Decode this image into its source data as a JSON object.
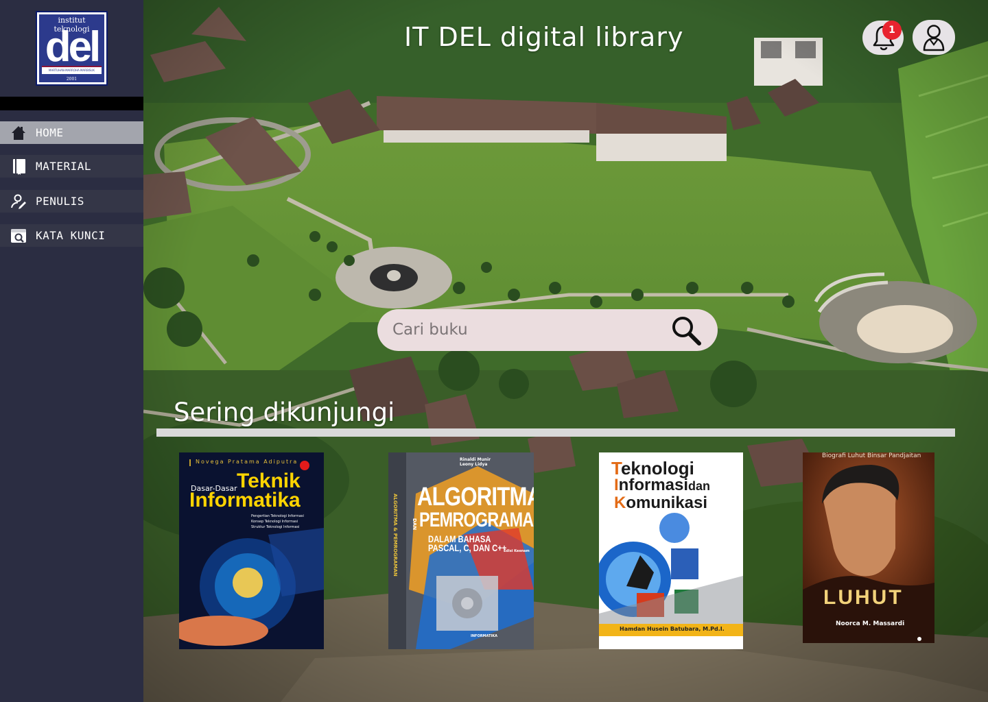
{
  "sidebar": {
    "logo": {
      "top_text": "institut teknologi",
      "word": "del",
      "motto": "MARTUHAN·MARROHA·MARBISUK",
      "year": "2001"
    },
    "items": [
      {
        "label": "HOME",
        "icon": "home-icon",
        "active": true
      },
      {
        "label": "MATERIAL",
        "icon": "book-icon",
        "active": false
      },
      {
        "label": "PENULIS",
        "icon": "author-icon",
        "active": false
      },
      {
        "label": "KATA KUNCI",
        "icon": "keyword-search-icon",
        "active": false
      }
    ]
  },
  "header": {
    "title": "IT DEL digital library",
    "notification_count": "1",
    "bell_icon": "bell-icon",
    "profile_icon": "user-icon"
  },
  "search": {
    "placeholder": "Cari buku",
    "value": "",
    "icon": "search-icon"
  },
  "section": {
    "title": "Sering dikunjungi"
  },
  "books": [
    {
      "author": "Novega Pratama Adiputra",
      "title_line1": "Dasar-Dasar",
      "title_line2": "Teknik",
      "title_line3": "Informatika",
      "bullets": [
        "Pengertian Teknologi Informasi",
        "Konsep Teknologi Informasi",
        "Struktur Teknologi Informasi"
      ]
    },
    {
      "authors": [
        "Rinaldi Munir",
        "Leony Lidya"
      ],
      "title_line1": "ALGORITMA",
      "title_dan": "DAN",
      "title_line2": "PEMROGRAMAN",
      "subtitle_line1": "DALAM BAHASA",
      "subtitle_line2": "PASCAL, C, DAN C++",
      "edition": "Edisi Keenam",
      "spine": "ALGORITMA & PEMROGRAMAN",
      "publisher": "INFORMATIKA"
    },
    {
      "title_t": "T",
      "title_line1": "eknologi",
      "title_i": "I",
      "title_line2": "nformasi",
      "title_dan": "dan",
      "title_k": "K",
      "title_line3": "omunikasi",
      "author": "Hamdan Husein Batubara, M.Pd.I."
    },
    {
      "subtitle": "Biografi Luhut Binsar Pandjaitan",
      "title": "LUHUT",
      "author": "Noorca M. Massardi"
    }
  ],
  "colors": {
    "sidebar_bg": "#2b2d42",
    "nav_item_bg": "#343647",
    "nav_active_bg": "#a3a5ad",
    "search_bg": "#ebdddf",
    "badge": "#e8232f",
    "header_btn_bg": "#e7e3e7"
  }
}
